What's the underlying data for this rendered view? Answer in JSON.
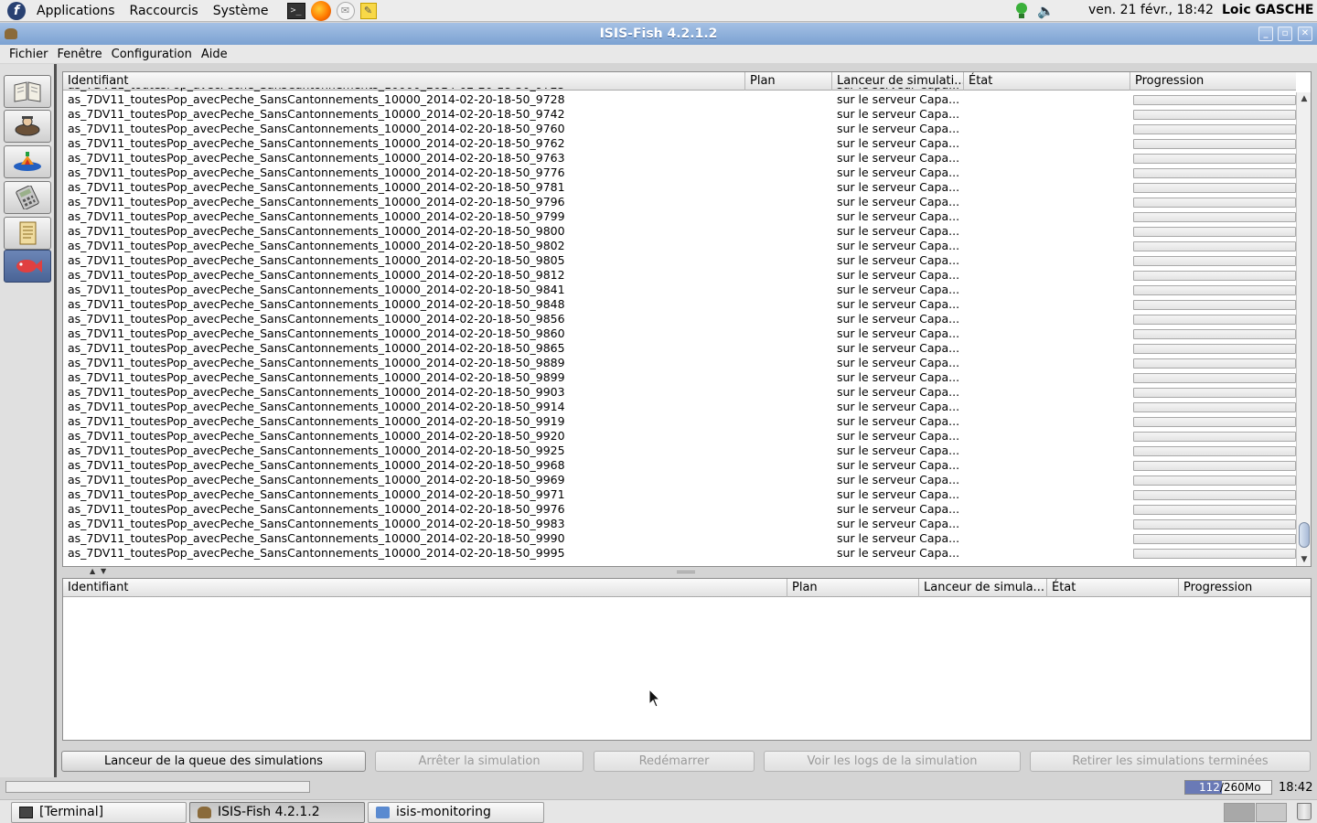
{
  "top_panel": {
    "menus": [
      "Applications",
      "Raccourcis",
      "Système"
    ],
    "clock": "ven. 21 févr., 18:42",
    "user": "Loic GASCHE"
  },
  "window": {
    "title": "ISIS-Fish 4.2.1.2"
  },
  "menubar": [
    "Fichier",
    "Fenêtre",
    "Configuration",
    "Aide"
  ],
  "upper_table": {
    "columns": [
      "Identifiant",
      "Plan",
      "Lanceur de simulati...",
      "État",
      "Progression"
    ],
    "rows": [
      {
        "id": "as_7DV11_toutesPop_avecPeche_SansCantonnements_10000_2014-02-20-18-50_9728",
        "plan": "",
        "launcher": "sur le serveur Capa...",
        "state": "",
        "progress": 0
      },
      {
        "id": "as_7DV11_toutesPop_avecPeche_SansCantonnements_10000_2014-02-20-18-50_9742",
        "plan": "",
        "launcher": "sur le serveur Capa...",
        "state": "",
        "progress": 0
      },
      {
        "id": "as_7DV11_toutesPop_avecPeche_SansCantonnements_10000_2014-02-20-18-50_9760",
        "plan": "",
        "launcher": "sur le serveur Capa...",
        "state": "",
        "progress": 0
      },
      {
        "id": "as_7DV11_toutesPop_avecPeche_SansCantonnements_10000_2014-02-20-18-50_9762",
        "plan": "",
        "launcher": "sur le serveur Capa...",
        "state": "",
        "progress": 0
      },
      {
        "id": "as_7DV11_toutesPop_avecPeche_SansCantonnements_10000_2014-02-20-18-50_9763",
        "plan": "",
        "launcher": "sur le serveur Capa...",
        "state": "",
        "progress": 0
      },
      {
        "id": "as_7DV11_toutesPop_avecPeche_SansCantonnements_10000_2014-02-20-18-50_9776",
        "plan": "",
        "launcher": "sur le serveur Capa...",
        "state": "",
        "progress": 0
      },
      {
        "id": "as_7DV11_toutesPop_avecPeche_SansCantonnements_10000_2014-02-20-18-50_9781",
        "plan": "",
        "launcher": "sur le serveur Capa...",
        "state": "",
        "progress": 0
      },
      {
        "id": "as_7DV11_toutesPop_avecPeche_SansCantonnements_10000_2014-02-20-18-50_9796",
        "plan": "",
        "launcher": "sur le serveur Capa...",
        "state": "",
        "progress": 0
      },
      {
        "id": "as_7DV11_toutesPop_avecPeche_SansCantonnements_10000_2014-02-20-18-50_9799",
        "plan": "",
        "launcher": "sur le serveur Capa...",
        "state": "",
        "progress": 0
      },
      {
        "id": "as_7DV11_toutesPop_avecPeche_SansCantonnements_10000_2014-02-20-18-50_9800",
        "plan": "",
        "launcher": "sur le serveur Capa...",
        "state": "",
        "progress": 0
      },
      {
        "id": "as_7DV11_toutesPop_avecPeche_SansCantonnements_10000_2014-02-20-18-50_9802",
        "plan": "",
        "launcher": "sur le serveur Capa...",
        "state": "",
        "progress": 0
      },
      {
        "id": "as_7DV11_toutesPop_avecPeche_SansCantonnements_10000_2014-02-20-18-50_9805",
        "plan": "",
        "launcher": "sur le serveur Capa...",
        "state": "",
        "progress": 0
      },
      {
        "id": "as_7DV11_toutesPop_avecPeche_SansCantonnements_10000_2014-02-20-18-50_9812",
        "plan": "",
        "launcher": "sur le serveur Capa...",
        "state": "",
        "progress": 0
      },
      {
        "id": "as_7DV11_toutesPop_avecPeche_SansCantonnements_10000_2014-02-20-18-50_9841",
        "plan": "",
        "launcher": "sur le serveur Capa...",
        "state": "",
        "progress": 0
      },
      {
        "id": "as_7DV11_toutesPop_avecPeche_SansCantonnements_10000_2014-02-20-18-50_9848",
        "plan": "",
        "launcher": "sur le serveur Capa...",
        "state": "",
        "progress": 0
      },
      {
        "id": "as_7DV11_toutesPop_avecPeche_SansCantonnements_10000_2014-02-20-18-50_9856",
        "plan": "",
        "launcher": "sur le serveur Capa...",
        "state": "",
        "progress": 0
      },
      {
        "id": "as_7DV11_toutesPop_avecPeche_SansCantonnements_10000_2014-02-20-18-50_9860",
        "plan": "",
        "launcher": "sur le serveur Capa...",
        "state": "",
        "progress": 0
      },
      {
        "id": "as_7DV11_toutesPop_avecPeche_SansCantonnements_10000_2014-02-20-18-50_9865",
        "plan": "",
        "launcher": "sur le serveur Capa...",
        "state": "",
        "progress": 0
      },
      {
        "id": "as_7DV11_toutesPop_avecPeche_SansCantonnements_10000_2014-02-20-18-50_9889",
        "plan": "",
        "launcher": "sur le serveur Capa...",
        "state": "",
        "progress": 0
      },
      {
        "id": "as_7DV11_toutesPop_avecPeche_SansCantonnements_10000_2014-02-20-18-50_9899",
        "plan": "",
        "launcher": "sur le serveur Capa...",
        "state": "",
        "progress": 0
      },
      {
        "id": "as_7DV11_toutesPop_avecPeche_SansCantonnements_10000_2014-02-20-18-50_9903",
        "plan": "",
        "launcher": "sur le serveur Capa...",
        "state": "",
        "progress": 0
      },
      {
        "id": "as_7DV11_toutesPop_avecPeche_SansCantonnements_10000_2014-02-20-18-50_9914",
        "plan": "",
        "launcher": "sur le serveur Capa...",
        "state": "",
        "progress": 0
      },
      {
        "id": "as_7DV11_toutesPop_avecPeche_SansCantonnements_10000_2014-02-20-18-50_9919",
        "plan": "",
        "launcher": "sur le serveur Capa...",
        "state": "",
        "progress": 0
      },
      {
        "id": "as_7DV11_toutesPop_avecPeche_SansCantonnements_10000_2014-02-20-18-50_9920",
        "plan": "",
        "launcher": "sur le serveur Capa...",
        "state": "",
        "progress": 0
      },
      {
        "id": "as_7DV11_toutesPop_avecPeche_SansCantonnements_10000_2014-02-20-18-50_9925",
        "plan": "",
        "launcher": "sur le serveur Capa...",
        "state": "",
        "progress": 0
      },
      {
        "id": "as_7DV11_toutesPop_avecPeche_SansCantonnements_10000_2014-02-20-18-50_9968",
        "plan": "",
        "launcher": "sur le serveur Capa...",
        "state": "",
        "progress": 0
      },
      {
        "id": "as_7DV11_toutesPop_avecPeche_SansCantonnements_10000_2014-02-20-18-50_9969",
        "plan": "",
        "launcher": "sur le serveur Capa...",
        "state": "",
        "progress": 0
      },
      {
        "id": "as_7DV11_toutesPop_avecPeche_SansCantonnements_10000_2014-02-20-18-50_9971",
        "plan": "",
        "launcher": "sur le serveur Capa...",
        "state": "",
        "progress": 0
      },
      {
        "id": "as_7DV11_toutesPop_avecPeche_SansCantonnements_10000_2014-02-20-18-50_9976",
        "plan": "",
        "launcher": "sur le serveur Capa...",
        "state": "",
        "progress": 0
      },
      {
        "id": "as_7DV11_toutesPop_avecPeche_SansCantonnements_10000_2014-02-20-18-50_9983",
        "plan": "",
        "launcher": "sur le serveur Capa...",
        "state": "",
        "progress": 0
      },
      {
        "id": "as_7DV11_toutesPop_avecPeche_SansCantonnements_10000_2014-02-20-18-50_9990",
        "plan": "",
        "launcher": "sur le serveur Capa...",
        "state": "",
        "progress": 0
      },
      {
        "id": "as_7DV11_toutesPop_avecPeche_SansCantonnements_10000_2014-02-20-18-50_9995",
        "plan": "",
        "launcher": "sur le serveur Capa...",
        "state": "",
        "progress": 0
      }
    ]
  },
  "lower_table": {
    "columns": [
      "Identifiant",
      "Plan",
      "Lanceur de simula...",
      "État",
      "Progression"
    ]
  },
  "buttons": {
    "queue_launcher": "Lanceur de la queue des simulations",
    "stop": "Arrêter la simulation",
    "restart": "Redémarrer",
    "view_logs": "Voir les logs de la simulation",
    "remove_finished": "Retirer les simulations terminées"
  },
  "status": {
    "memory_used": "112",
    "memory_total": "260Mo",
    "memory_used_fraction": 0.43,
    "time": "18:42"
  },
  "taskbar": {
    "tasks": [
      "[Terminal]",
      "ISIS-Fish 4.2.1.2",
      "isis-monitoring"
    ]
  }
}
